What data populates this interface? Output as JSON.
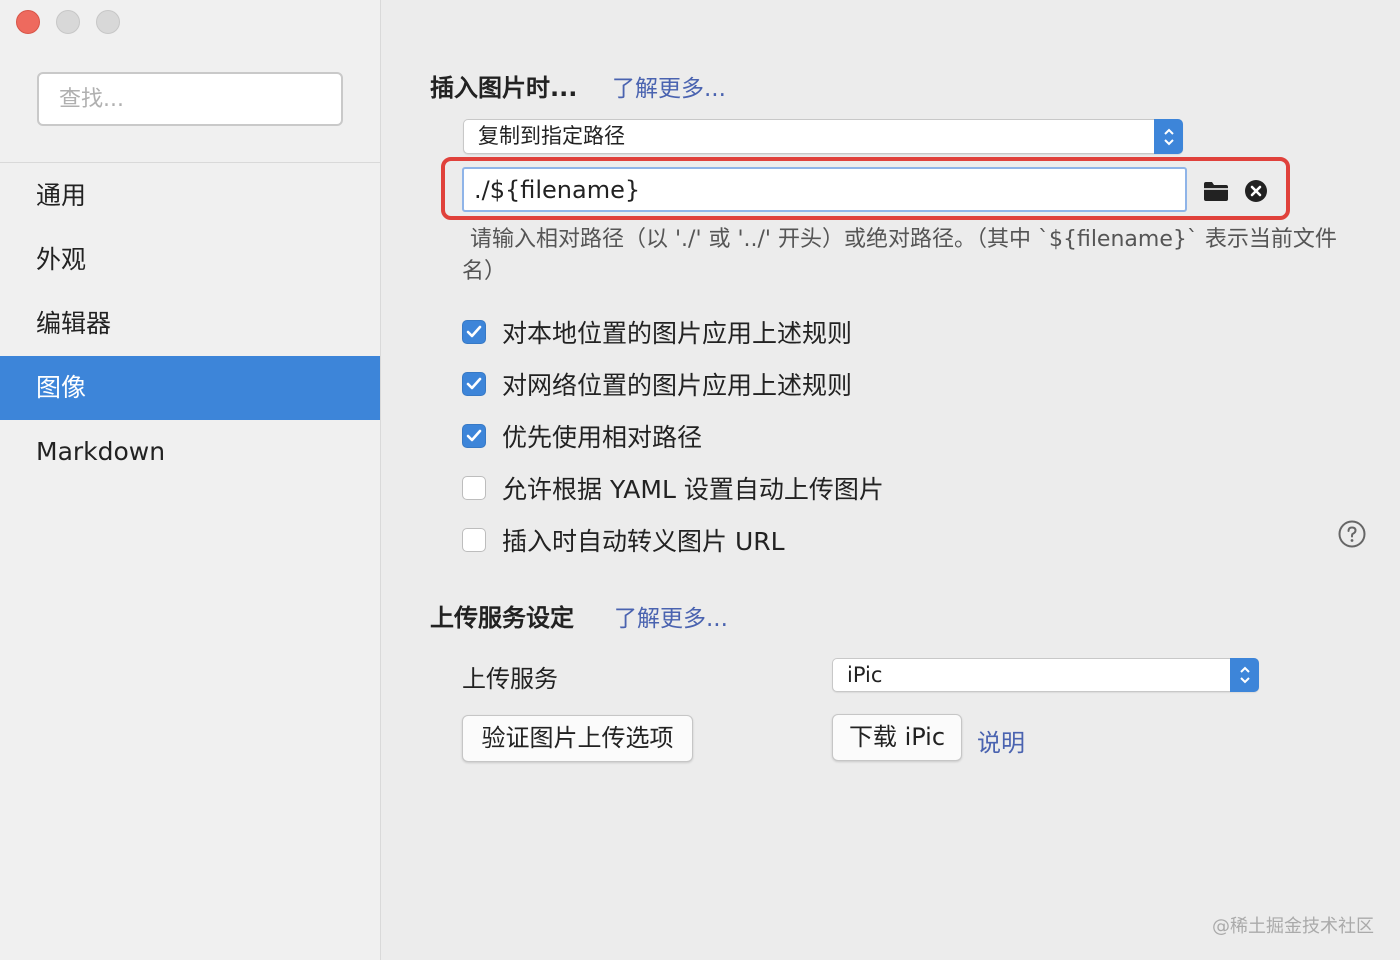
{
  "sidebar": {
    "search_placeholder": "查找...",
    "items": [
      {
        "label": "通用",
        "active": false
      },
      {
        "label": "外观",
        "active": false
      },
      {
        "label": "编辑器",
        "active": false
      },
      {
        "label": "图像",
        "active": true
      },
      {
        "label": "Markdown",
        "active": false
      }
    ]
  },
  "insert_image": {
    "title": "插入图片时...",
    "learn_more": "了解更多...",
    "action_select": "复制到指定路径",
    "path_value": "./${filename}",
    "hint": "请输入相对路径（以 './' 或 '../' 开头）或绝对路径。（其中 `${filename}` 表示当前文件名）",
    "options": [
      {
        "label": "对本地位置的图片应用上述规则",
        "checked": true
      },
      {
        "label": "对网络位置的图片应用上述规则",
        "checked": true
      },
      {
        "label": "优先使用相对路径",
        "checked": true
      },
      {
        "label": "允许根据 YAML 设置自动上传图片",
        "checked": false
      },
      {
        "label": "插入时自动转义图片 URL",
        "checked": false
      }
    ]
  },
  "upload": {
    "title": "上传服务设定",
    "learn_more": "了解更多...",
    "service_label": "上传服务",
    "service_value": "iPic",
    "verify_button": "验证图片上传选项",
    "download_button": "下载 iPic",
    "explain_link": "说明"
  },
  "watermark": "@稀土掘金技术社区",
  "colors": {
    "accent": "#3d85d9",
    "link": "#4a63b0",
    "highlight": "#e0413b",
    "close_button": "#ee6a5e"
  },
  "icons": [
    "folder-icon",
    "clear-icon",
    "help-icon",
    "checkmark-icon",
    "chevron-updown-icon"
  ]
}
